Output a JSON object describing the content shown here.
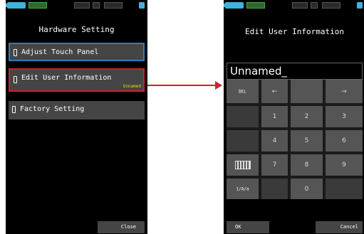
{
  "left_screen": {
    "title": "Hardware Setting",
    "menu": [
      {
        "label": "Adjust Touch Panel",
        "value": ""
      },
      {
        "label": "Edit User Information",
        "value": "Unnamed"
      },
      {
        "label": "Factory Setting",
        "value": ""
      }
    ],
    "close_label": "Close"
  },
  "right_screen": {
    "title": "Edit User Information",
    "entry_value": "Unnamed_",
    "keys": {
      "del": "DEL",
      "left": "←",
      "right": "→",
      "k1": "1",
      "k2": "2",
      "k3": "3",
      "k4": "4",
      "k5": "5",
      "k6": "6",
      "k7": "7",
      "k8": "8",
      "k9": "9",
      "k0": "0",
      "mode": "1/A/a"
    },
    "ok_label": "OK",
    "cancel_label": "Cancel"
  },
  "colors": {
    "highlight_red": "#d0202c",
    "highlight_blue": "#2c7fbf",
    "value_yellow": "#e6d800",
    "battery_blue": "#3fb3dc"
  },
  "icons": [
    "battery-icon",
    "menu-item-icon",
    "keyboard-icon",
    "arrow-right-icon"
  ]
}
